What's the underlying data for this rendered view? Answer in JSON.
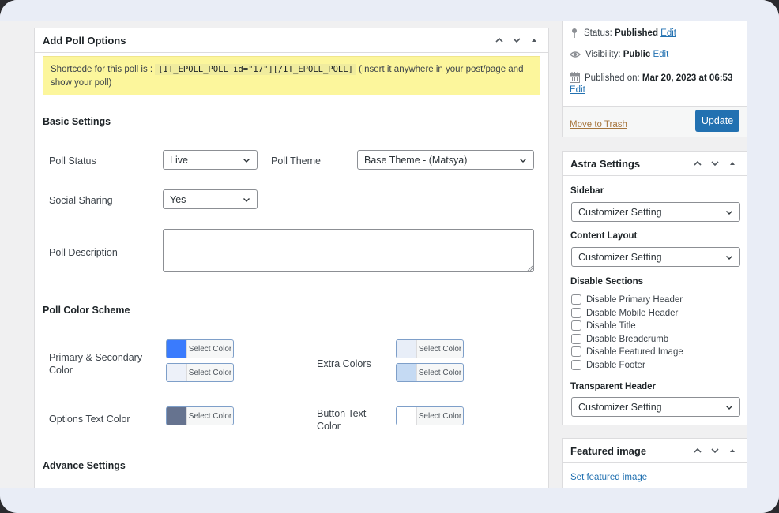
{
  "poll_box": {
    "title": "Add Poll Options",
    "notice": {
      "prefix": "Shortcode for this poll is :",
      "shortcode": "[IT_EPOLL_POLL id=\"17\"][/IT_EPOLL_POLL]",
      "suffix": "(Insert it anywhere in your post/page and show your poll)"
    },
    "basic_settings": {
      "title": "Basic Settings",
      "poll_status_label": "Poll Status",
      "poll_status_value": "Live",
      "poll_theme_label": "Poll Theme",
      "poll_theme_value": "Base Theme - (Matsya)",
      "social_sharing_label": "Social Sharing",
      "social_sharing_value": "Yes",
      "poll_description_label": "Poll Description",
      "poll_description_value": ""
    },
    "color_scheme": {
      "title": "Poll Color Scheme",
      "primary_secondary_label": "Primary & Secondary Color",
      "extra_colors_label": "Extra Colors",
      "options_text_label": "Options Text Color",
      "button_text_label": "Button Text Color",
      "select_color_label": "Select Color",
      "colors": {
        "primary": "#3a7bfd",
        "secondary": "#edf1f9",
        "extra_1": "#e8eef8",
        "extra_2": "#c5daf3",
        "options_text": "#66738f",
        "button_text": "#ffffff"
      }
    },
    "advance_settings": {
      "title": "Advance Settings"
    }
  },
  "publish_box": {
    "status_label": "Status:",
    "status_value": "Published",
    "visibility_label": "Visibility:",
    "visibility_value": "Public",
    "published_label": "Published on:",
    "published_value": "Mar 20, 2023 at 06:53",
    "edit_label": "Edit",
    "trash_label": "Move to Trash",
    "update_label": "Update"
  },
  "astra_box": {
    "title": "Astra Settings",
    "sidebar_label": "Sidebar",
    "sidebar_value": "Customizer Setting",
    "content_layout_label": "Content Layout",
    "content_layout_value": "Customizer Setting",
    "disable_sections_label": "Disable Sections",
    "checkboxes": [
      {
        "label": "Disable Primary Header",
        "checked": false
      },
      {
        "label": "Disable Mobile Header",
        "checked": false
      },
      {
        "label": "Disable Title",
        "checked": false
      },
      {
        "label": "Disable Breadcrumb",
        "checked": false
      },
      {
        "label": "Disable Featured Image",
        "checked": false
      },
      {
        "label": "Disable Footer",
        "checked": false
      }
    ],
    "transparent_header_label": "Transparent Header",
    "transparent_header_value": "Customizer Setting"
  },
  "featured_box": {
    "title": "Featured image",
    "set_link": "Set featured image"
  },
  "colors": {
    "accent": "#2271b1",
    "notice_bg": "#fcf69c",
    "frame_bg": "#e9edf6"
  }
}
